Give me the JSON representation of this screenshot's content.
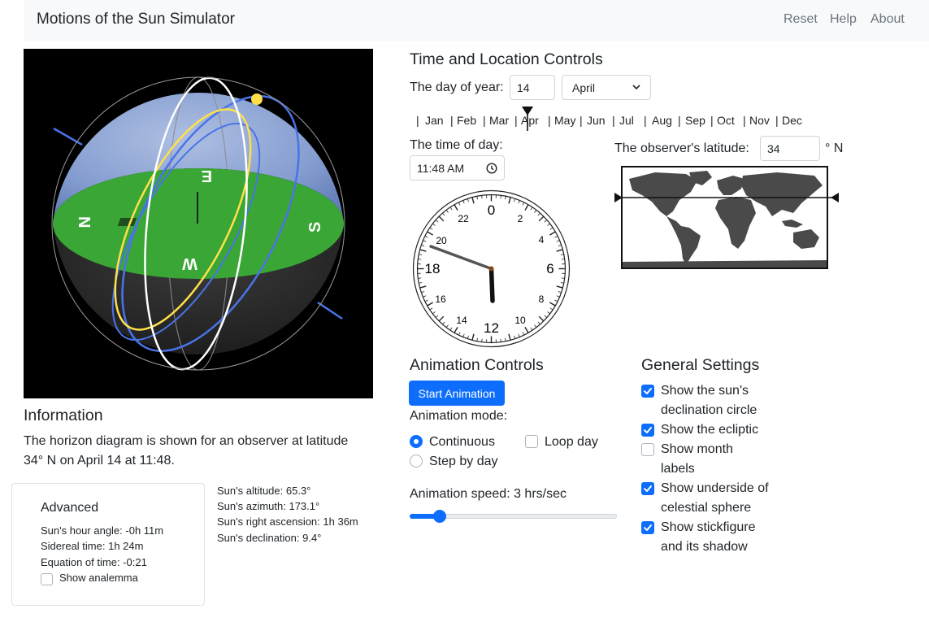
{
  "navbar": {
    "title": "Motions of the Sun Simulator",
    "links": [
      "Reset",
      "Help",
      "About"
    ]
  },
  "sphere": {
    "direction_labels": [
      "N",
      "E",
      "S",
      "W"
    ]
  },
  "controls": {
    "heading": "Time and Location Controls",
    "day_label": "The day of year:",
    "day_value": "14",
    "month_value": "April",
    "months": [
      "Jan",
      "Feb",
      "Mar",
      "Apr",
      "May",
      "Jun",
      "Jul",
      "Aug",
      "Sep",
      "Oct",
      "Nov",
      "Dec"
    ],
    "time_label": "The time of day:",
    "time_value": "11:48 AM",
    "latitude_label": "The observer's latitude:",
    "latitude_value": "34",
    "latitude_unit": "° N"
  },
  "clock": {
    "major_labels": [
      "0",
      "6",
      "12",
      "18"
    ],
    "minor_labels": [
      "2",
      "4",
      "8",
      "10",
      "14",
      "16",
      "20",
      "22"
    ]
  },
  "animation": {
    "heading": "Animation Controls",
    "start_label": "Start Animation",
    "mode_label": "Animation mode:",
    "mode_continuous": "Continuous",
    "mode_step": "Step by day",
    "loop_label": "Loop day",
    "speed_label": "Animation speed: 3 hrs/sec",
    "speed_fraction": 0.12
  },
  "settings": {
    "heading": "General Settings",
    "items": [
      {
        "label": "Show the sun's declination circle",
        "lines": [
          "Show the sun's",
          "declination circle"
        ],
        "checked": true
      },
      {
        "label": "Show the ecliptic",
        "lines": [
          "Show the ecliptic"
        ],
        "checked": true
      },
      {
        "label": "Show month labels",
        "lines": [
          "Show month",
          "labels"
        ],
        "checked": false
      },
      {
        "label": "Show underside of celestial sphere",
        "lines": [
          "Show underside of",
          "celestial sphere"
        ],
        "checked": true
      },
      {
        "label": "Show stickfigure and its shadow",
        "lines": [
          "Show stickfigure",
          "and its shadow"
        ],
        "checked": true
      }
    ]
  },
  "information": {
    "heading": "Information",
    "line1": "The horizon diagram is shown for an observer at latitude",
    "line2": "34° N on April 14 at 11:48."
  },
  "advanced": {
    "heading": "Advanced",
    "hour_angle": "Sun's hour angle: -0h 11m",
    "sidereal": "Sidereal time: 1h 24m",
    "eq_time": "Equation of time: -0:21",
    "analemma": "Show analemma"
  },
  "sun_data": {
    "altitude": "Sun's altitude: 65.3°",
    "azimuth": "Sun's azimuth: 173.1°",
    "ra": "Sun's right ascension: 1h 36m",
    "declination": "Sun's declination: 9.4°"
  },
  "colors": {
    "primary": "#0d6efd",
    "horizon_green": "#3aa635",
    "sky_blue": "#8aa9e0",
    "ecliptic_yellow": "#ffe04a",
    "declination_blue": "#4a73e8"
  }
}
